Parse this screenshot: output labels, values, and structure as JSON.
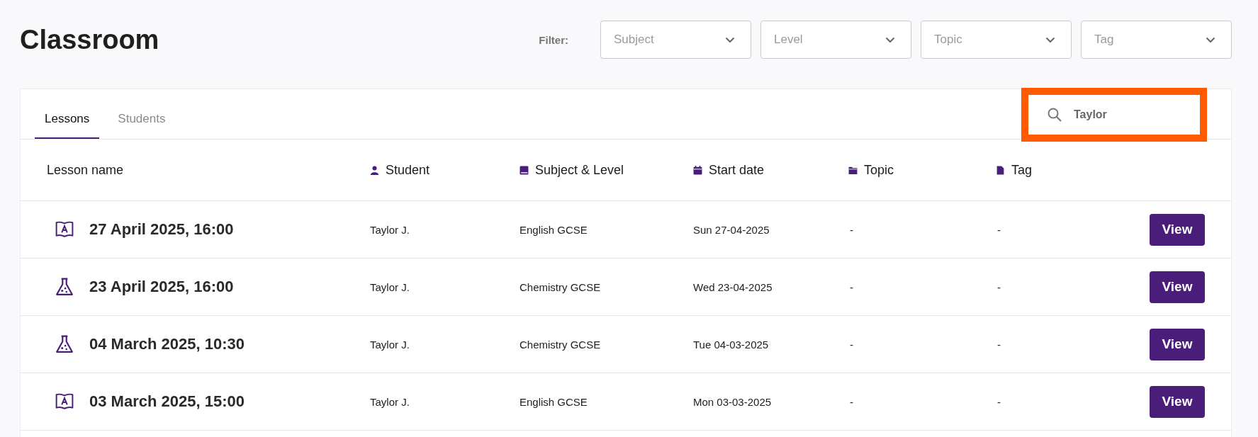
{
  "header": {
    "title": "Classroom",
    "filter_label": "Filter:"
  },
  "filters": [
    {
      "placeholder": "Subject"
    },
    {
      "placeholder": "Level"
    },
    {
      "placeholder": "Topic"
    },
    {
      "placeholder": "Tag"
    }
  ],
  "tabs": [
    {
      "label": "Lessons",
      "selected": true
    },
    {
      "label": "Students",
      "selected": false
    }
  ],
  "search": {
    "value": "Taylor",
    "highlighted": true
  },
  "table": {
    "columns": [
      {
        "label": "Lesson name",
        "kind": "none"
      },
      {
        "label": "Student",
        "kind": "person"
      },
      {
        "label": "Subject & Level",
        "kind": "book"
      },
      {
        "label": "Start date",
        "kind": "calendar"
      },
      {
        "label": "Topic",
        "kind": "folder"
      },
      {
        "label": "Tag",
        "kind": "file"
      }
    ],
    "rows": [
      {
        "kind": "book",
        "name": "27 April 2025, 16:00",
        "student": "Taylor J.",
        "subject": "English GCSE",
        "date": "Sun 27-04-2025",
        "topic": "-",
        "tag": "-",
        "action": "View"
      },
      {
        "kind": "flask",
        "name": "23 April 2025, 16:00",
        "student": "Taylor J.",
        "subject": "Chemistry GCSE",
        "date": "Wed 23-04-2025",
        "topic": "-",
        "tag": "-",
        "action": "View"
      },
      {
        "kind": "flask",
        "name": "04 March 2025, 10:30",
        "student": "Taylor J.",
        "subject": "Chemistry GCSE",
        "date": "Tue 04-03-2025",
        "topic": "-",
        "tag": "-",
        "action": "View"
      },
      {
        "kind": "book",
        "name": "03 March 2025, 15:00",
        "student": "Taylor J.",
        "subject": "English GCSE",
        "date": "Mon 03-03-2025",
        "topic": "-",
        "tag": "-",
        "action": "View"
      }
    ]
  }
}
